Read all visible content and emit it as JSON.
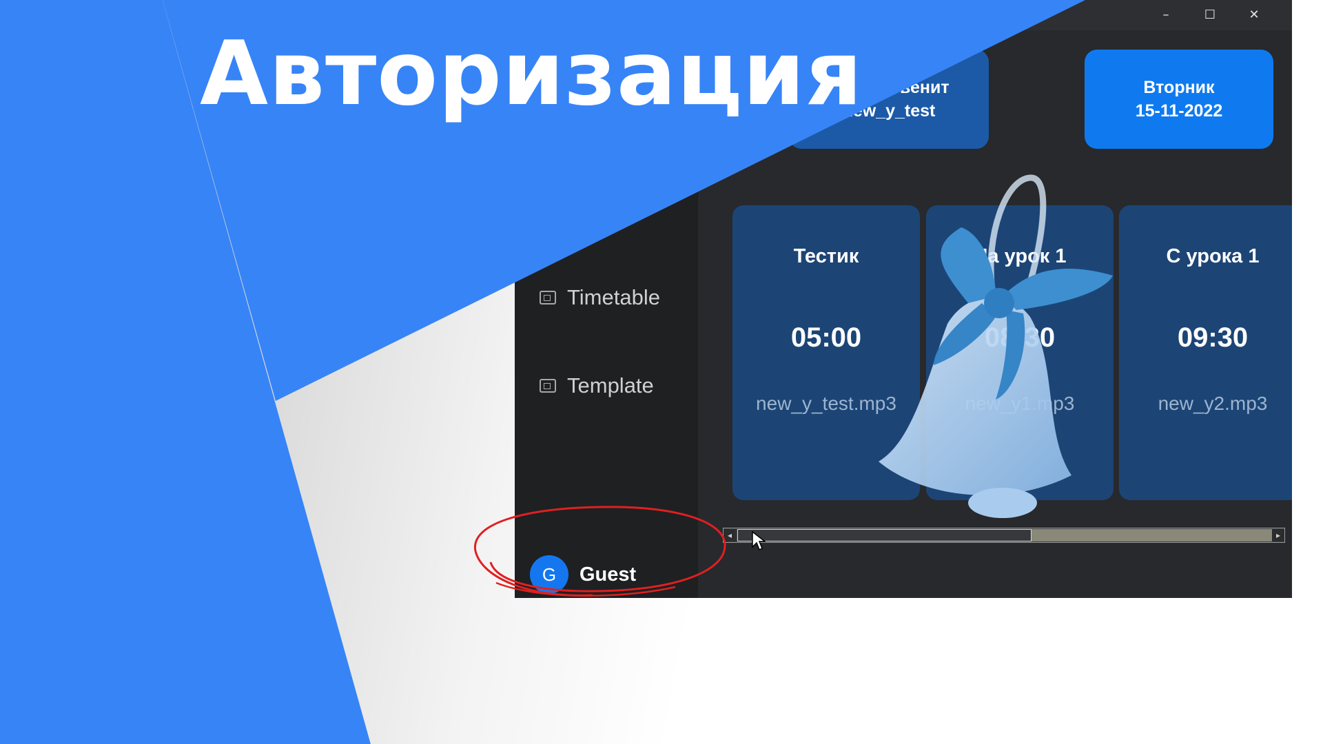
{
  "slide": {
    "headline": "Авторизация",
    "colors": {
      "accent_blue": "#3784f7",
      "annotation_red": "#e02020"
    }
  },
  "window": {
    "controls": {
      "minimize": "–",
      "maximize": "☐",
      "close": "✕"
    }
  },
  "header_cards": [
    {
      "line1": "…у прозвенит",
      "line2": "new_y_test"
    },
    {
      "line1": "Вторник",
      "line2": "15-11-2022"
    }
  ],
  "sidebar": {
    "items": [
      {
        "label": "Timetable",
        "icon": "timetable-icon"
      },
      {
        "label": "Template",
        "icon": "template-icon"
      }
    ],
    "user": {
      "initial": "G",
      "name": "Guest"
    }
  },
  "bells": [
    {
      "name": "Тестик",
      "time": "05:00",
      "file": "new_y_test.mp3"
    },
    {
      "name": "На урок 1",
      "time": "08:30",
      "file": "new_y1.mp3"
    },
    {
      "name": "С урока 1",
      "time": "09:30",
      "file": "new_y2.mp3"
    }
  ],
  "scrollbar": {
    "position": 0.55
  }
}
